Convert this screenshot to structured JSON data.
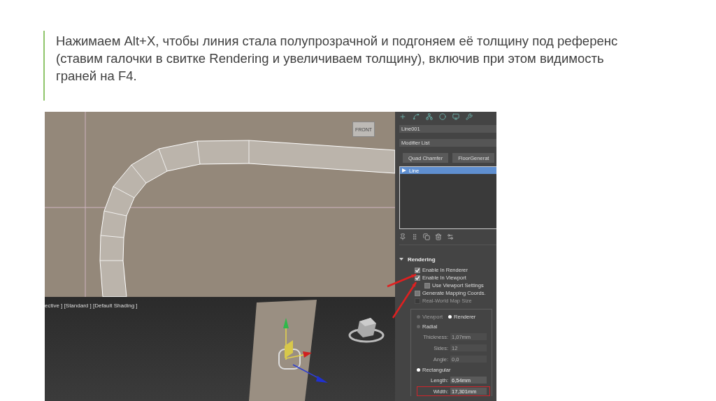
{
  "slide": {
    "paragraph": "Нажимаем Alt+X, чтобы линия стала полупрозрачной и подгоняем её толщину под референс (ставим галочки в свитке Rendering и увеличиваем толщину), включив при этом видимость граней на F4."
  },
  "viewport_top": {
    "viewcube_label": "FRONT"
  },
  "viewport_bottom": {
    "label": "ective ] [Standard ] [Default Shading ]"
  },
  "command_panel": {
    "object_name": "Line001",
    "modifier_list": "Modifier List",
    "buttons": [
      "Quad Chamfer",
      "FloorGenerat"
    ],
    "stack": [
      {
        "label": "Line",
        "selected": true
      }
    ],
    "rollout": {
      "title": "Rendering",
      "expanded": true,
      "checkboxes": [
        {
          "label": "Enable In Renderer",
          "checked": true,
          "disabled": false,
          "indented": false,
          "pointed": true
        },
        {
          "label": "Enable In Viewport",
          "checked": true,
          "disabled": false,
          "indented": false,
          "pointed": true
        },
        {
          "label": "Use Viewport Settings",
          "checked": false,
          "disabled": false,
          "indented": true,
          "pointed": false
        },
        {
          "label": "Generate Mapping Coords.",
          "checked": false,
          "disabled": false,
          "indented": false,
          "pointed": false
        },
        {
          "label": "Real-World Map Size",
          "checked": false,
          "disabled": true,
          "indented": false,
          "pointed": false
        }
      ],
      "mode_radios": [
        {
          "label": "Viewport",
          "selected": false,
          "disabled": true
        },
        {
          "label": "Renderer",
          "selected": true,
          "disabled": false
        }
      ],
      "sections": [
        {
          "label": "Radial",
          "selected": false,
          "fields": [
            {
              "label": "Thickness:",
              "value": "1,07mm",
              "highlighted": false
            },
            {
              "label": "Sides:",
              "value": "12",
              "highlighted": false
            },
            {
              "label": "Angle:",
              "value": "0,0",
              "highlighted": false
            }
          ]
        },
        {
          "label": "Rectangular",
          "selected": true,
          "fields": [
            {
              "label": "Length:",
              "value": "6,54mm",
              "highlighted": false
            },
            {
              "label": "Width:",
              "value": "17,301mm",
              "highlighted": true
            }
          ]
        }
      ]
    }
  }
}
